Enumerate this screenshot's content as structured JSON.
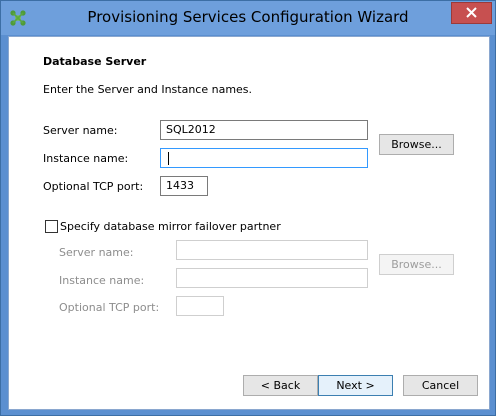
{
  "window": {
    "title": "Provisioning Services Configuration Wizard"
  },
  "page": {
    "heading": "Database Server",
    "description": "Enter the Server and Instance names."
  },
  "primary": {
    "server_label": "Server name:",
    "server_value": "SQL2012",
    "instance_label": "Instance name:",
    "instance_value": "",
    "port_label": "Optional TCP port:",
    "port_value": "1433",
    "browse_label": "Browse..."
  },
  "mirror": {
    "checkbox_label": "Specify database mirror failover partner",
    "checked": false,
    "server_label": "Server name:",
    "server_value": "",
    "instance_label": "Instance name:",
    "instance_value": "",
    "port_label": "Optional TCP port:",
    "port_value": "",
    "browse_label": "Browse..."
  },
  "footer": {
    "back_label": "< Back",
    "next_label": "Next >",
    "cancel_label": "Cancel"
  },
  "colors": {
    "titlebar": "#6e9fdc",
    "close_button": "#c75050",
    "focus_border": "#3399ff"
  },
  "icons": {
    "app": "citrix-icon",
    "close": "close-icon"
  }
}
